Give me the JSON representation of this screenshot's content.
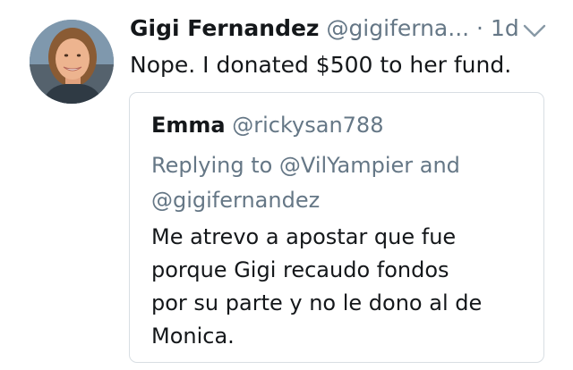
{
  "tweet": {
    "author_name": "Gigi Fernandez",
    "author_handle": "@gigiferna...",
    "time": "· 1d",
    "text": "Nope. I donated $500 to her fund.",
    "avatar_icon": "profile-photo",
    "menu_icon": "chevron-down-icon"
  },
  "quoted": {
    "author_name": "Emma",
    "author_handle": "@rickysan788",
    "replying_line1": "Replying to @VilYampier and",
    "replying_line2": "@gigifernandez",
    "text_lines": [
      "Me atrevo a apostar que fue",
      "porque Gigi recaudo fondos",
      "por su parte y no le dono al de",
      "Monica."
    ]
  },
  "colors": {
    "primary_text": "#14171a",
    "secondary_text": "#657786",
    "border": "#d8dee3"
  }
}
